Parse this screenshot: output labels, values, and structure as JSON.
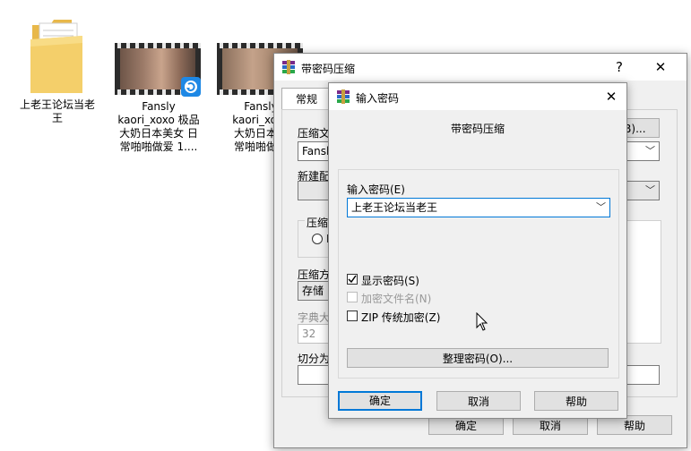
{
  "desktop": {
    "files": [
      {
        "label": "上老王论坛当老\n王"
      },
      {
        "label": "Fansly\nkaori_xoxo 极品\n大奶日本美女 日\n常啪啪做爱 1...."
      },
      {
        "label": "Fansly\nkaori_xoxo\n大奶日本美\n常啪啪做爱"
      }
    ]
  },
  "back_dialog": {
    "title": "带密码压缩",
    "help_label": "?",
    "close_label": "✕",
    "tab_general": "常规",
    "archive_name_label": "压缩文",
    "archive_name_value": "Fansly",
    "browse_label": "(B)...",
    "update_mode_label": "新建配",
    "archive_format_label": "压缩文",
    "radio_label": "R",
    "compression_method_label": "压缩方",
    "compression_method_value": "存储",
    "dict_size_label": "字典大",
    "dict_size_value": "32",
    "split_label": "切分为",
    "ok_label": "确定",
    "cancel_label": "取消",
    "help_button_label": "帮助"
  },
  "front_dialog": {
    "title": "输入密码",
    "close_label": "✕",
    "heading": "带密码压缩",
    "password_label": "输入密码(E)",
    "password_value": "上老王论坛当老王",
    "show_password_label": "显示密码(S)",
    "show_password_checked": true,
    "encrypt_filenames_label": "加密文件名(N)",
    "zip_legacy_label": "ZIP 传统加密(Z)",
    "organize_label": "整理密码(O)...",
    "ok_label": "确定",
    "cancel_label": "取消",
    "help_label": "帮助"
  },
  "icons": [
    "folder-icon",
    "video-thumbnail-icon",
    "sync-badge-icon",
    "winrar-icon",
    "close-icon",
    "help-icon",
    "chevron-down-icon",
    "mouse-cursor-icon"
  ]
}
